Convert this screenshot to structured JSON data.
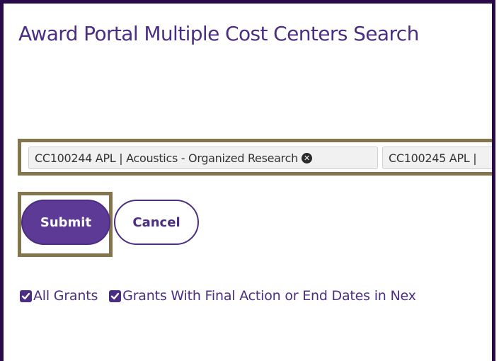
{
  "page": {
    "title": "Award Portal Multiple Cost Centers Search"
  },
  "cost_center_tags": [
    {
      "code": "CC100244 APL",
      "separator": "|",
      "name": "Acoustics - Organized Research"
    },
    {
      "code": "CC100245 APL",
      "separator": "|",
      "name": ""
    }
  ],
  "buttons": {
    "submit_label": "Submit",
    "cancel_label": "Cancel"
  },
  "filters": [
    {
      "label": "All Grants",
      "checked": true
    },
    {
      "label": "Grants With Final Action or End Dates in Nex",
      "checked": true
    }
  ],
  "colors": {
    "brand_purple": "#4b2e83",
    "button_purple": "#5c3a95",
    "highlight_gold": "#85754d",
    "frame_dark": "#2a0b4a"
  },
  "icons": {
    "tag_remove": "circle-x-icon",
    "checkbox": "checkmark-icon"
  }
}
